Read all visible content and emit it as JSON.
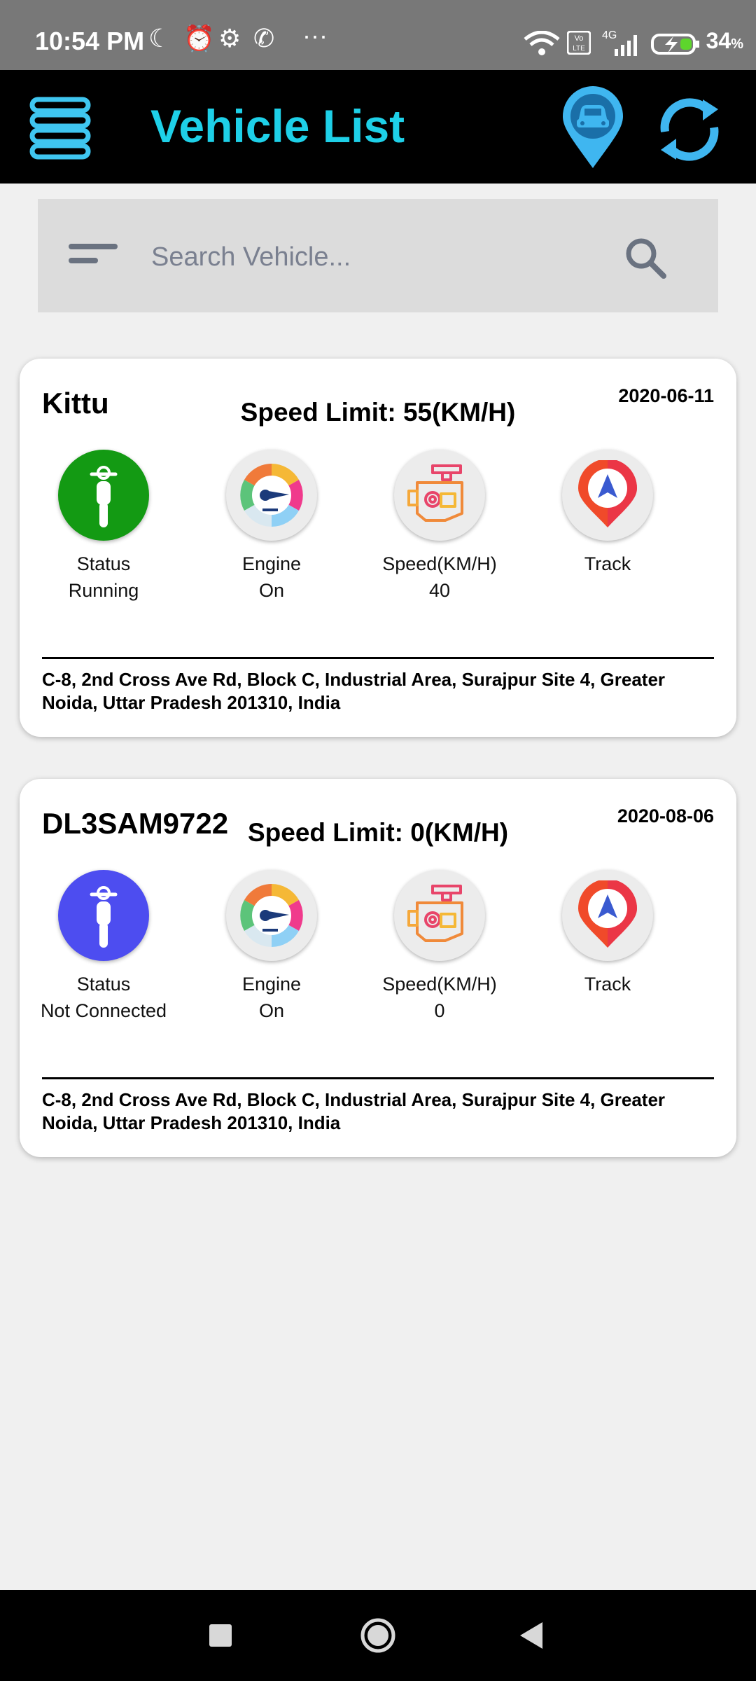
{
  "status_bar": {
    "time": "10:54 PM",
    "battery": "34",
    "network": "4G"
  },
  "app_bar": {
    "title": "Vehicle List",
    "title_color": "#1ed0e8",
    "icons": [
      "menu-icon",
      "vehicle-location-icon",
      "refresh-icon"
    ]
  },
  "search": {
    "placeholder": "Search Vehicle...",
    "value": ""
  },
  "vehicles": [
    {
      "name": "Kittu",
      "speed_limit": "Speed Limit: 55(KM/H)",
      "date": "2020-06-11",
      "status_label": "Status",
      "status_value": "Running",
      "status_color": "#139a13",
      "engine_label": "Engine",
      "engine_value": "On",
      "speed_label": "Speed(KM/H)",
      "speed_value": "40",
      "track_label": "Track",
      "address": "C-8, 2nd Cross Ave Rd, Block C, Industrial Area, Surajpur Site 4, Greater Noida, Uttar Pradesh 201310, India"
    },
    {
      "name": "DL3SAM9722",
      "speed_limit": "Speed Limit: 0(KM/H)",
      "date": "2020-08-06",
      "status_label": "Status",
      "status_value": "Not Connected",
      "status_color": "#4d4df0",
      "engine_label": "Engine",
      "engine_value": "On",
      "speed_label": "Speed(KM/H)",
      "speed_value": "0",
      "track_label": "Track",
      "address": "C-8, 2nd Cross Ave Rd, Block C, Industrial Area, Surajpur Site 4, Greater Noida, Uttar Pradesh 201310, India"
    }
  ],
  "nav_bar": {
    "buttons": [
      "recents-button",
      "home-button",
      "back-button"
    ]
  }
}
